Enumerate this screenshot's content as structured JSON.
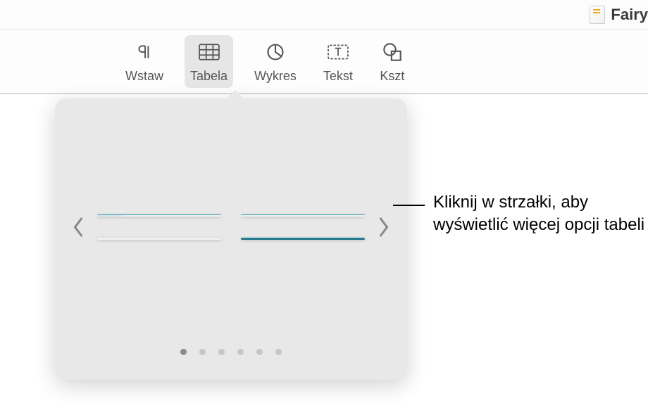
{
  "document": {
    "title": "Fairy "
  },
  "toolbar": {
    "items": [
      {
        "label": "Wstaw"
      },
      {
        "label": "Tabela"
      },
      {
        "label": "Wykres"
      },
      {
        "label": "Tekst"
      },
      {
        "label": "Kszt"
      }
    ]
  },
  "popover": {
    "page_count": 6,
    "active_page": 0
  },
  "callout": {
    "text": "Kliknij w strzałki, aby wyświetlić więcej opcji tabeli"
  }
}
